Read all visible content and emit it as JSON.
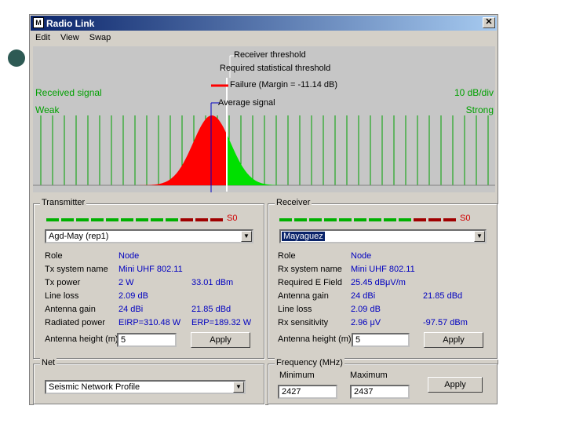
{
  "window": {
    "title": "Radio Link",
    "app_icon": "radio-link-app-icon",
    "close": "✕"
  },
  "menu": [
    "Edit",
    "View",
    "Swap"
  ],
  "plot": {
    "receiver_threshold": "Receiver threshold",
    "required_statistical_threshold": "Required statistical threshold",
    "failure": "Failure (Margin = -11.14 dB)",
    "average_signal": "Average signal",
    "received_signal": "Received signal",
    "weak": "Weak",
    "scale": "10 dB/div",
    "strong": "Strong",
    "colors": {
      "failure": "#ff0000",
      "success": "#00e000",
      "threshold": "#ff0000",
      "average": "#0000c0"
    }
  },
  "transmitter": {
    "title": "Transmitter",
    "level": "S0",
    "selected": "Agd-May (rep1)",
    "role_label": "Role",
    "role_value": "Node",
    "system_label": "Tx system name",
    "system_value": "Mini UHF 802.11",
    "power_label": "Tx power",
    "power_value": "2 W",
    "power_value2": "33.01 dBm",
    "loss_label": "Line loss",
    "loss_value": "2.09 dB",
    "gain_label": "Antenna gain",
    "gain_value": "24 dBi",
    "gain_value2": "21.85 dBd",
    "rad_label": "Radiated power",
    "rad_value": "EIRP=310.48 W",
    "rad_value2": "ERP=189.32 W",
    "height_label": "Antenna height (m)",
    "height_value": "5",
    "apply": "Apply"
  },
  "receiver": {
    "title": "Receiver",
    "level": "S0",
    "selected": "Mayaguez",
    "role_label": "Role",
    "role_value": "Node",
    "system_label": "Rx system name",
    "system_value": "Mini UHF 802.11",
    "field_label": "Required E Field",
    "field_value": "25.45 dBμV/m",
    "gain_label": "Antenna gain",
    "gain_value": "24 dBi",
    "gain_value2": "21.85 dBd",
    "loss_label": "Line loss",
    "loss_value": "2.09 dB",
    "sens_label": "Rx sensitivity",
    "sens_value": "2.96 μV",
    "sens_value2": "-97.57 dBm",
    "height_label": "Antenna height (m)",
    "height_value": "5",
    "apply": "Apply"
  },
  "net": {
    "title": "Net",
    "selected": "Seismic Network Profile"
  },
  "frequency": {
    "title": "Frequency (MHz)",
    "min_label": "Minimum",
    "min_value": "2427",
    "max_label": "Maximum",
    "max_value": "2437",
    "apply": "Apply"
  }
}
